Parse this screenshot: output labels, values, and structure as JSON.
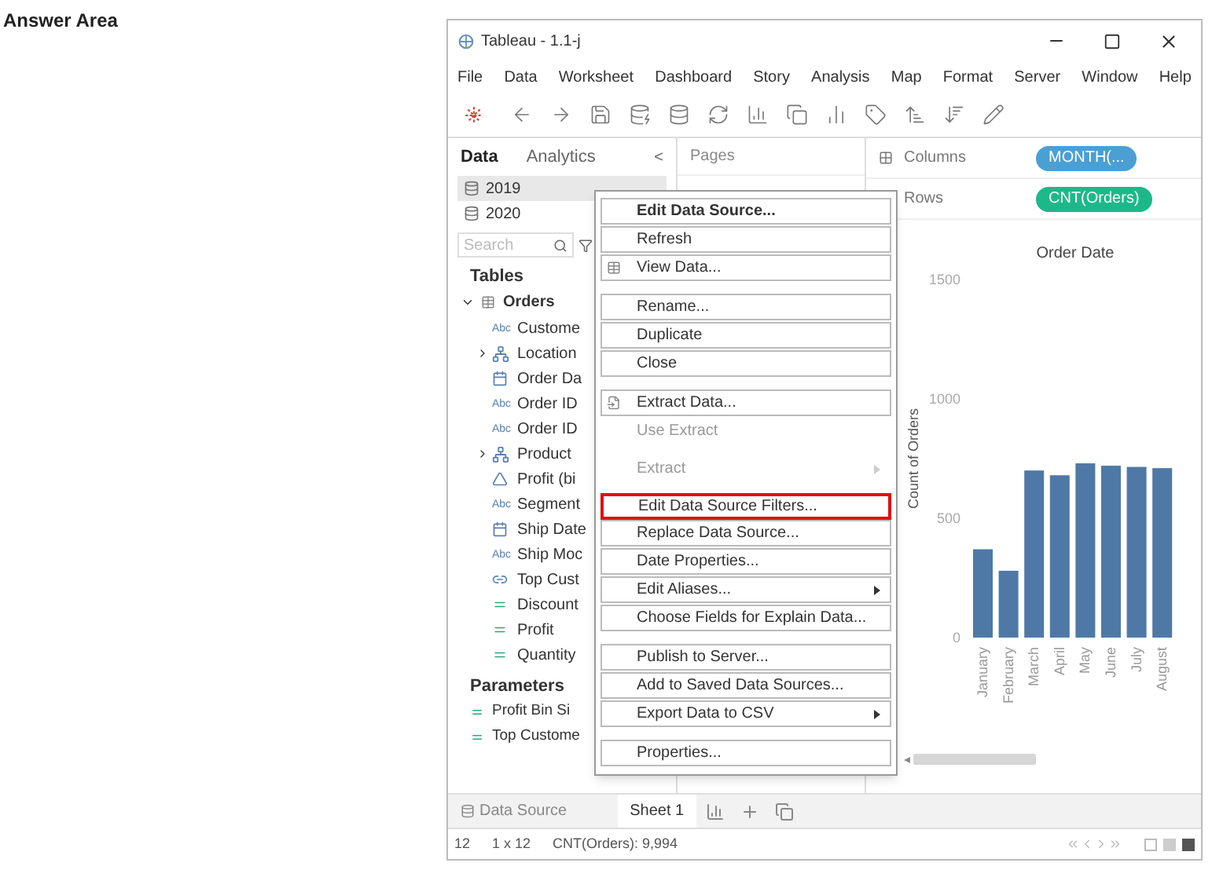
{
  "heading": "Answer Area",
  "window": {
    "title": "Tableau - 1.1-j"
  },
  "menu_bar": [
    "File",
    "Data",
    "Worksheet",
    "Dashboard",
    "Story",
    "Analysis",
    "Map",
    "Format",
    "Server",
    "Window",
    "Help"
  ],
  "side_tabs": [
    {
      "label": "Data",
      "selected": true
    },
    {
      "label": "Analytics",
      "selected": false
    }
  ],
  "collapse_glyph": "<",
  "data_sources": [
    {
      "label": "2019",
      "selected": true
    },
    {
      "label": "2020",
      "selected": false
    }
  ],
  "search": {
    "placeholder": "Search"
  },
  "tables_heading": "Tables",
  "tables": [
    {
      "label": "Orders",
      "expanded": true,
      "children": [
        {
          "label": "Custome",
          "kind": "string",
          "type_label": "Abc"
        },
        {
          "label": "Location",
          "kind": "hierarchy",
          "expanded": false
        },
        {
          "label": "Order Da",
          "kind": "date"
        },
        {
          "label": "Order ID",
          "kind": "string",
          "type_label": "Abc"
        },
        {
          "label": "Order ID",
          "kind": "string",
          "type_label": "Abc"
        },
        {
          "label": "Product",
          "kind": "hierarchy",
          "expanded": false
        },
        {
          "label": "Profit (bi",
          "kind": "bin"
        },
        {
          "label": "Segment",
          "kind": "string",
          "type_label": "Abc"
        },
        {
          "label": "Ship Date",
          "kind": "date"
        },
        {
          "label": "Ship Moc",
          "kind": "string",
          "type_label": "Abc"
        },
        {
          "label": "Top Cust",
          "kind": "set"
        },
        {
          "label": "Discount",
          "kind": "measure"
        },
        {
          "label": "Profit",
          "kind": "measure"
        },
        {
          "label": "Quantity",
          "kind": "measure"
        }
      ]
    }
  ],
  "parameters_heading": "Parameters",
  "parameters": [
    "Profit Bin Si",
    "Top Custome"
  ],
  "pages_label": "Pages",
  "shelves": [
    {
      "label": "Columns",
      "kind": "columns",
      "pill": {
        "label": "MONTH(...",
        "color": "#4a9fd5"
      }
    },
    {
      "label": "Rows",
      "kind": "rows",
      "pill": {
        "label": "CNT(Orders)",
        "color": "#1db88a"
      }
    }
  ],
  "chart_data": {
    "type": "bar",
    "title": "Order Date",
    "ylabel": "Count of Orders",
    "categories": [
      "January",
      "February",
      "March",
      "April",
      "May",
      "June",
      "July",
      "August"
    ],
    "values": [
      370,
      280,
      700,
      680,
      730,
      720,
      715,
      710
    ],
    "ylim": [
      0,
      1500
    ],
    "yticks": [
      0,
      500,
      1000,
      1500
    ]
  },
  "context_menu": [
    {
      "kind": "item",
      "label": "Edit Data Source...",
      "bold": true,
      "selected": false
    },
    {
      "kind": "item",
      "label": "Refresh",
      "selected": false
    },
    {
      "kind": "table_item",
      "label": "View Data...",
      "selected": false
    },
    {
      "kind": "separator"
    },
    {
      "kind": "item",
      "label": "Rename...",
      "selected": false
    },
    {
      "kind": "item",
      "label": "Duplicate",
      "selected": false
    },
    {
      "kind": "item",
      "label": "Close",
      "selected": false
    },
    {
      "kind": "separator"
    },
    {
      "kind": "extract_item",
      "label": "Extract Data...",
      "selected": false
    },
    {
      "kind": "item",
      "label": "Use Extract",
      "disabled": true,
      "selected": false
    },
    {
      "kind": "separator"
    },
    {
      "kind": "item",
      "label": "Extract",
      "disabled": true,
      "submenu": true,
      "selected": false
    },
    {
      "kind": "separator"
    },
    {
      "kind": "item",
      "label": "Edit Data Source Filters...",
      "selected": true
    },
    {
      "kind": "item",
      "label": "Replace Data Source...",
      "selected": false
    },
    {
      "kind": "item",
      "label": "Date Properties...",
      "selected": false
    },
    {
      "kind": "item",
      "label": "Edit Aliases...",
      "submenu": true,
      "selected": false
    },
    {
      "kind": "item",
      "label": "Choose Fields for Explain Data...",
      "selected": false
    },
    {
      "kind": "separator"
    },
    {
      "kind": "item",
      "label": "Publish to Server...",
      "selected": false
    },
    {
      "kind": "item",
      "label": "Add to Saved Data Sources...",
      "selected": false
    },
    {
      "kind": "item",
      "label": "Export Data to CSV",
      "submenu": true,
      "selected": false
    },
    {
      "kind": "separator"
    },
    {
      "kind": "item",
      "label": "Properties...",
      "selected": false
    }
  ],
  "sheet_tabs": [
    {
      "label": "Data Source",
      "kind": "data_source",
      "selected": false
    },
    {
      "label": "Sheet 1",
      "kind": "sheet",
      "selected": true
    }
  ],
  "status_bar": [
    "12",
    "1 x 12",
    "CNT(Orders): 9,994"
  ]
}
